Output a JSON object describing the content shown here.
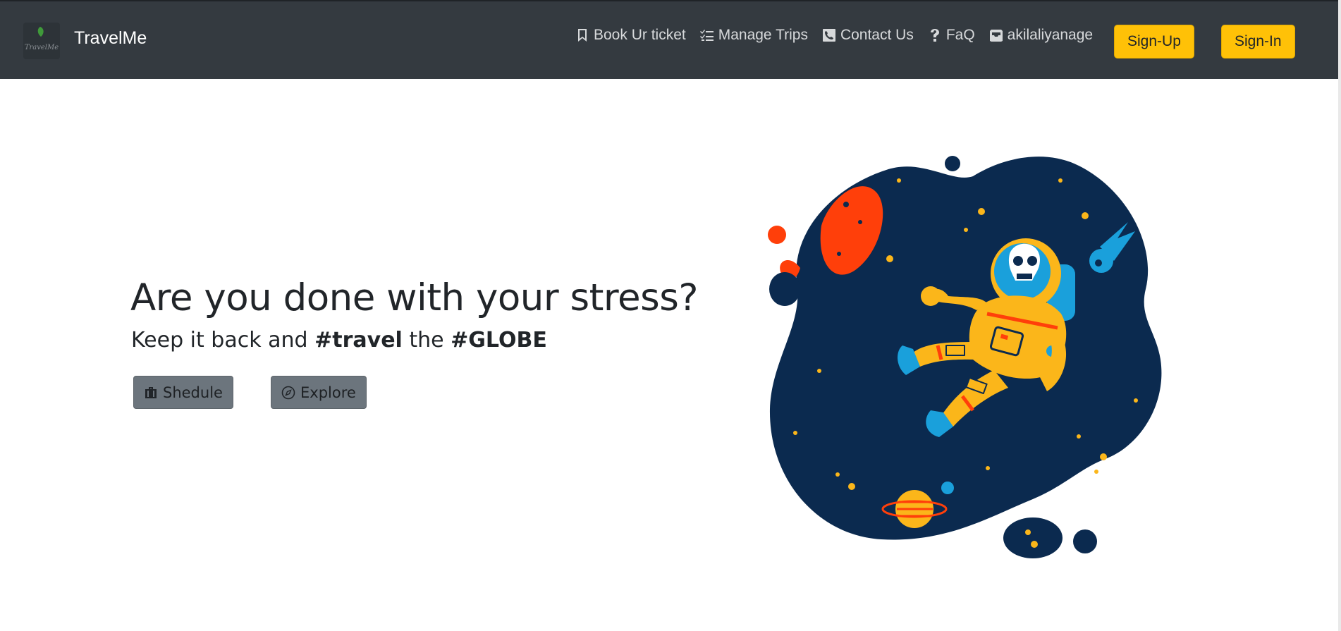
{
  "navbar": {
    "brand_name": "TravelMe",
    "logo_text": "TravelMe",
    "links": [
      {
        "label": "Book Ur ticket",
        "icon": "bookmark-icon"
      },
      {
        "label": "Manage Trips",
        "icon": "list-check-icon"
      },
      {
        "label": "Contact Us",
        "icon": "phone-icon"
      },
      {
        "label": "FaQ",
        "icon": "question-icon"
      },
      {
        "label": "akilaliyanage",
        "icon": "user-inbox-icon"
      }
    ],
    "signup_label": "Sign-Up",
    "signin_label": "Sign-In"
  },
  "hero": {
    "title": "Are you done with your stress?",
    "subtitle_pre": "Keep it back and ",
    "subtitle_tag1": "#travel",
    "subtitle_mid": " the ",
    "subtitle_tag2": "#GLOBE",
    "schedule_label": "Shedule",
    "explore_label": "Explore"
  },
  "colors": {
    "navbar_bg": "#343a40",
    "accent_yellow": "#ffc107",
    "button_gray": "#6c757d",
    "space_navy": "#0b2a4f",
    "planet_red": "#ff3f0a",
    "astronaut_yellow": "#fbb61a",
    "comet_blue": "#1aa0db"
  }
}
